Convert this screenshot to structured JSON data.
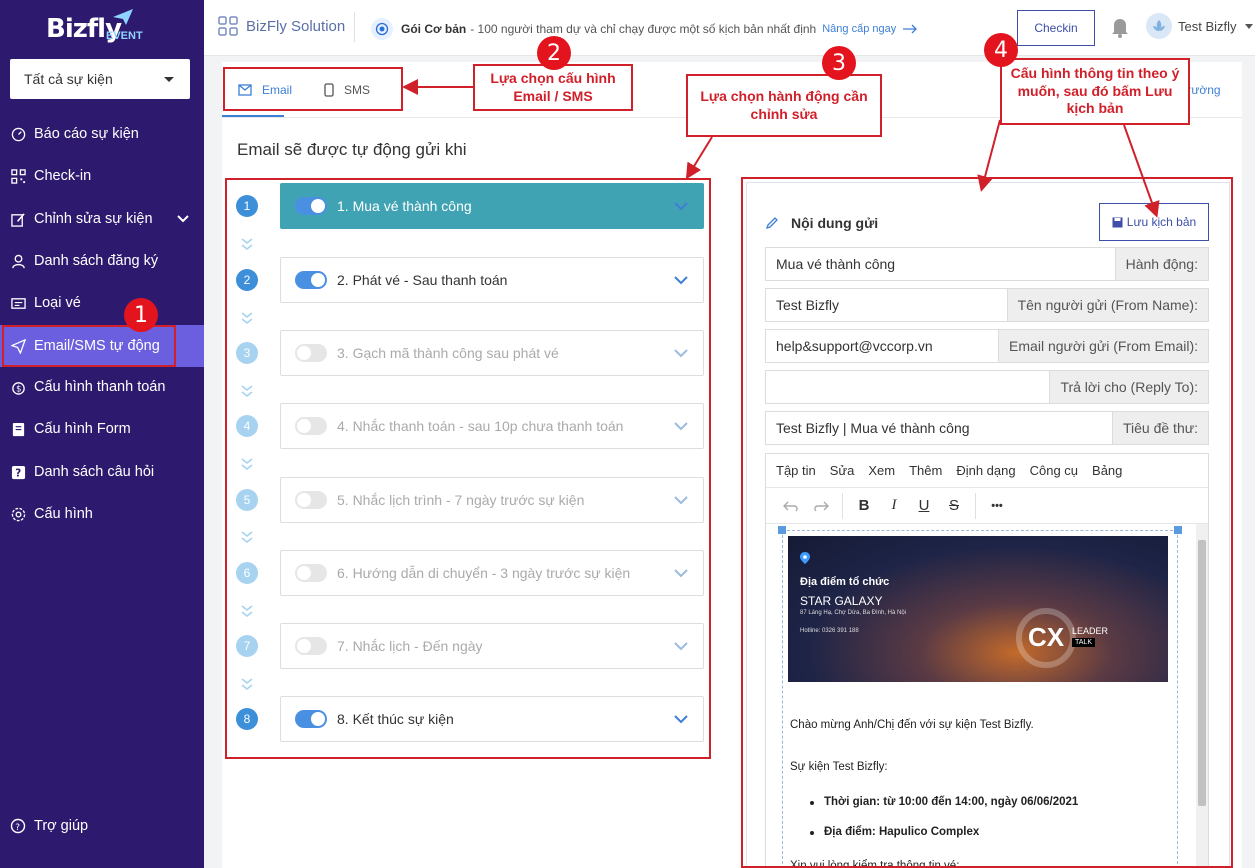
{
  "app": {
    "logo_text": "Bizfly",
    "logo_sub": "EVENT",
    "event_selector": "Tất cả sự kiện"
  },
  "sidebar": {
    "items": [
      {
        "label": "Báo cáo sự kiện",
        "icon": "gauge-icon"
      },
      {
        "label": "Check-in",
        "icon": "qr-icon"
      },
      {
        "label": "Chỉnh sửa sự kiện",
        "icon": "edit-icon"
      },
      {
        "label": "Danh sách đăng ký",
        "icon": "user-icon"
      },
      {
        "label": "Loại vé",
        "icon": "ticket-icon"
      },
      {
        "label": "Email/SMS tự động",
        "icon": "send-icon"
      },
      {
        "label": "Cấu hình thanh toán",
        "icon": "money-icon"
      },
      {
        "label": "Cấu hình Form",
        "icon": "form-icon"
      },
      {
        "label": "Danh sách câu hỏi",
        "icon": "question-icon"
      },
      {
        "label": "Cấu hình",
        "icon": "gear-icon"
      }
    ],
    "active_index": 5,
    "help_label": "Trợ giúp"
  },
  "header": {
    "solution_label": "BizFly Solution",
    "plan_name": "Gói Cơ bản",
    "plan_desc": "- 100 người tham dự và chỉ chạy được một số kịch bản nhất định",
    "upgrade_link": "Nâng cấp ngay",
    "checkin_button": "Checkin",
    "user_name": "Test Bizfly"
  },
  "main": {
    "tabs": [
      {
        "label": "Email",
        "icon": "mail-icon"
      },
      {
        "label": "SMS",
        "icon": "phone-icon"
      }
    ],
    "right_link_fragment": "trường",
    "section_title": "Email sẽ được tự động gửi khi",
    "steps": [
      {
        "num": "1",
        "label": "1. Mua vé thành công",
        "enabled": true,
        "selected": true
      },
      {
        "num": "2",
        "label": "2. Phát vé - Sau thanh toán",
        "enabled": true,
        "selected": false
      },
      {
        "num": "3",
        "label": "3. Gạch mã thành công sau phát vé",
        "enabled": false,
        "selected": false
      },
      {
        "num": "4",
        "label": "4. Nhắc thanh toán - sau 10p chưa thanh toán",
        "enabled": false,
        "selected": false
      },
      {
        "num": "5",
        "label": "5. Nhắc lịch trình - 7 ngày trước sự kiện",
        "enabled": false,
        "selected": false
      },
      {
        "num": "6",
        "label": "6. Hướng dẫn di chuyển - 3 ngày trước sự kiện",
        "enabled": false,
        "selected": false
      },
      {
        "num": "7",
        "label": "7. Nhắc lịch - Đến ngày",
        "enabled": false,
        "selected": false
      },
      {
        "num": "8",
        "label": "8. Kết thúc sự kiện",
        "enabled": true,
        "selected": false
      }
    ]
  },
  "panel": {
    "title": "Nội dung gửi",
    "save_button": "Lưu kịch bản",
    "fields": [
      {
        "value": "Mua vé thành công",
        "label": "Hành động:"
      },
      {
        "value": "Test Bizfly",
        "label": "Tên người gửi (From Name):"
      },
      {
        "value": "help&support@vccorp.vn",
        "label": "Email người gửi (From Email):"
      },
      {
        "value": "",
        "label": "Trả lời cho (Reply To):"
      },
      {
        "value": "Test Bizfly | Mua vé thành công",
        "label": "Tiêu đề thư:"
      }
    ],
    "menubar": [
      "Tập tin",
      "Sửa",
      "Xem",
      "Thêm",
      "Định dạng",
      "Công cụ",
      "Bảng"
    ],
    "toolbar": {
      "bold": "B",
      "italic": "I",
      "underline": "U",
      "strike": "S",
      "more": "•••"
    },
    "banner": {
      "heading": "Địa điểm tổ chức",
      "venue": "STAR GALAXY",
      "address": "87 Láng Hạ, Chợ Dừa, Ba Đình, Hà Nội",
      "hotline": "Hotline: 0326 391 188",
      "logo_cx": "CX",
      "logo_leader": "LEADER",
      "logo_talk": "TALK"
    },
    "body": {
      "greeting": "Chào mừng Anh/Chị đến với sự kiện Test Bizfly.",
      "event_line": "Sự kiện Test Bizfly:",
      "time_line": "Thời gian: từ 10:00 đến 14:00, ngày 06/06/2021",
      "place_line": "Địa điểm: Hapulico Complex",
      "cutoff_line": "Xin vui lòng kiểm tra thông tin vé:"
    }
  },
  "annotations": {
    "badges": [
      "1",
      "2",
      "3",
      "4"
    ],
    "callout2": "Lựa chọn cấu hình Email / SMS",
    "callout3": "Lựa chọn hành động cần chỉnh sửa",
    "callout4": "Cấu hình thông tin theo ý muốn, sau đó bấm Lưu kịch bản",
    "color": "#d0202a"
  },
  "colors": {
    "sidebar_bg": "#2d1a6e",
    "sidebar_active": "#6b5fe0",
    "selected_step": "#40a3b3",
    "accent": "#3d7fd6"
  }
}
